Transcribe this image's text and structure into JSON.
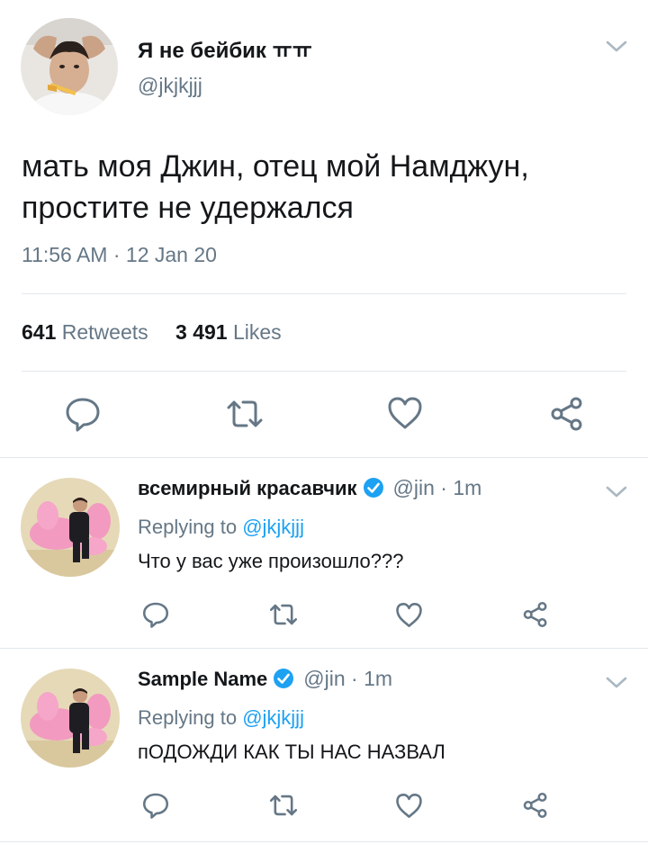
{
  "main_tweet": {
    "display_name": "Я не бейбик ㅠㅠ",
    "handle": "@jkjkjjj",
    "text": "мать моя Джин, отец мой Намджун, простите не удержался",
    "timestamp": "11:56 AM · 12 Jan 20",
    "retweets_count": "641",
    "retweets_label": "Retweets",
    "likes_count": "3 491",
    "likes_label": "Likes"
  },
  "replies": [
    {
      "display_name": "всемирный красавчик",
      "verified": true,
      "meta": "@jin · 1m",
      "replying_prefix": "Replying to ",
      "replying_to": "@jkjkjjj",
      "text": "Что у вас уже произошло???"
    },
    {
      "display_name": "Sample Name",
      "verified": true,
      "meta": "@jin · 1m",
      "replying_prefix": "Replying to ",
      "replying_to": "@jkjkjjj",
      "text": "пОДОЖДИ КАК ТЫ НАС НАЗВАЛ"
    }
  ],
  "icons": {
    "reply": "reply-icon",
    "retweet": "retweet-icon",
    "like": "heart-icon",
    "share": "share-icon",
    "chevron": "chevron-down-icon",
    "verified": "verified-badge-icon"
  },
  "colors": {
    "text_primary": "#14171a",
    "text_secondary": "#657786",
    "link": "#1da1f2",
    "divider": "#e1e8ed",
    "verified": "#1da1f2"
  }
}
